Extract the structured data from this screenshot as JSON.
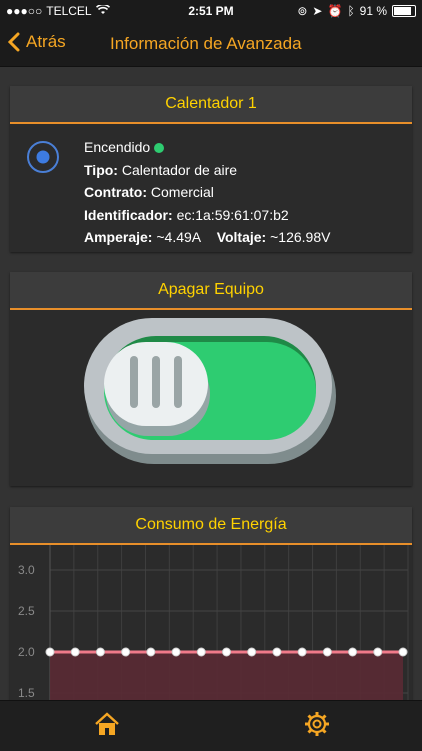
{
  "status_bar": {
    "carrier": "TELCEL",
    "time": "2:51 PM",
    "battery": "91 %"
  },
  "nav": {
    "back_label": "Atrás",
    "title": "Información de Avanzada"
  },
  "device_card": {
    "title": "Calentador 1",
    "status": "Encendido",
    "type_label": "Tipo:",
    "type_value": "Calentador de aire",
    "contract_label": "Contrato:",
    "contract_value": "Comercial",
    "id_label": "Identificador:",
    "id_value": "ec:1a:59:61:07:b2",
    "amp_label": "Amperaje:",
    "amp_value": "~4.49A",
    "volt_label": "Voltaje:",
    "volt_value": "~126.98V"
  },
  "power_card": {
    "title": "Apagar Equipo",
    "switch_on": true
  },
  "energy_card": {
    "title": "Consumo de Energía"
  },
  "colors": {
    "accent": "#f5a623",
    "header_text": "#ffd200",
    "switch_green": "#2ecc71",
    "line": "#f07a8a"
  },
  "chart_data": {
    "type": "area",
    "title": "Consumo de Energía",
    "xlabel": "",
    "ylabel": "",
    "y_ticks": [
      "3.0",
      "2.5",
      "2.0",
      "1.5"
    ],
    "ylim": [
      1.5,
      3.0
    ],
    "grid": true,
    "series": [
      {
        "values": [
          2.0,
          2.0,
          2.0,
          2.0,
          2.0,
          2.0,
          2.0,
          2.0,
          2.0,
          2.0,
          2.0,
          2.0,
          2.0,
          2.0,
          2.0
        ]
      }
    ]
  },
  "tab_bar": {
    "items": [
      {
        "icon": "home-icon"
      },
      {
        "icon": "gear-icon"
      }
    ]
  }
}
